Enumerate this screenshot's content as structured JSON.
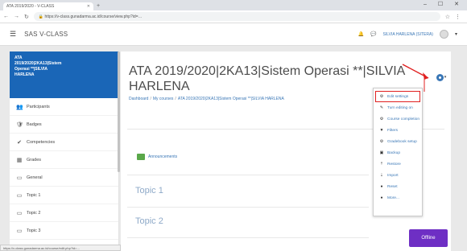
{
  "browser": {
    "tab_title": "ATA 2019/2020 - V-CLASS",
    "url": "https://v-class.gunadarma.ac.id/course/view.php?id=…",
    "url_host": "v-class.gunadarma.ac.id"
  },
  "navbar": {
    "brand": "SAS V-CLASS",
    "username": "SILVIA HARLENA (SITERA)"
  },
  "drawer": {
    "active_line1": "ATA",
    "active_line2": "2019/2020|2KA13|Sistem",
    "active_line3": "Operasi **|SILVIA",
    "active_line4": "HARLENA",
    "items": [
      {
        "label": "Participants",
        "icon": "users-icon"
      },
      {
        "label": "Badges",
        "icon": "badge-icon"
      },
      {
        "label": "Competencies",
        "icon": "competency-icon"
      },
      {
        "label": "Grades",
        "icon": "grades-icon"
      },
      {
        "label": "General",
        "icon": "folder-icon"
      },
      {
        "label": "Topic 1",
        "icon": "folder-icon"
      },
      {
        "label": "Topic 2",
        "icon": "folder-icon"
      },
      {
        "label": "Topic 3",
        "icon": "folder-icon"
      }
    ]
  },
  "main": {
    "title": "ATA 2019/2020|2KA13|Sistem Operasi **|SILVIA HARLENA",
    "breadcrumb": [
      "Dashboard",
      "My courses",
      "ATA 2019/2020|2KA13|Sistem Operasi **|SILVIA HARLENA"
    ],
    "announcements": "Announcements",
    "topics": [
      "Topic 1",
      "Topic 2"
    ]
  },
  "dropdown": {
    "items": [
      {
        "label": "Edit settings",
        "icon": "gear-icon"
      },
      {
        "label": "Turn editing on",
        "icon": "pencil-icon"
      },
      {
        "label": "Course completion",
        "icon": "completion-icon"
      },
      {
        "label": "Filters",
        "icon": "filter-icon"
      },
      {
        "label": "Gradebook setup",
        "icon": "gradebook-icon"
      },
      {
        "label": "Backup",
        "icon": "backup-icon"
      },
      {
        "label": "Restore",
        "icon": "restore-icon"
      },
      {
        "label": "Import",
        "icon": "import-icon"
      },
      {
        "label": "Reset",
        "icon": "reset-icon"
      },
      {
        "label": "More...",
        "icon": "more-icon"
      }
    ]
  },
  "offline_badge": "Offline",
  "statusbar": "https://v-class.gunadarma.ac.id/course/edit.php?id=…",
  "colors": {
    "accent": "#1a66b7",
    "link": "#3a77b6",
    "offline": "#6e2fc4",
    "highlight": "#e02020"
  }
}
